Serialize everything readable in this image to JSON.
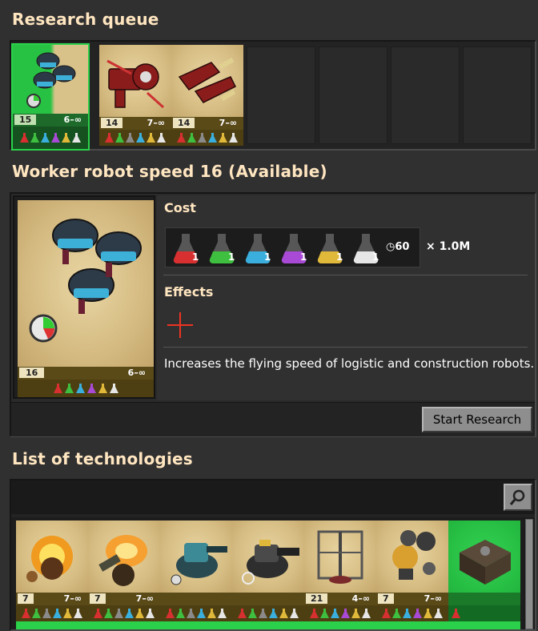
{
  "queue": {
    "title": "Research queue",
    "items": [
      {
        "level": "15",
        "range": "6–∞",
        "name": "Worker robot speed",
        "state": "active"
      },
      {
        "level": "14",
        "range": "7–∞",
        "name": "Physical projectile damage",
        "state": "queued"
      },
      {
        "level": "14",
        "range": "7–∞",
        "name": "Weapon shooting speed",
        "state": "queued"
      }
    ]
  },
  "selected": {
    "title": "Worker robot speed 16 (Available)",
    "level": "16",
    "range": "6–∞",
    "cost_label": "Cost",
    "packs": [
      {
        "color": "#d83030",
        "count": "1",
        "name": "automation-science-pack"
      },
      {
        "color": "#3fbf3f",
        "count": "1",
        "name": "logistic-science-pack"
      },
      {
        "color": "#3aaedc",
        "count": "1",
        "name": "chemical-science-pack"
      },
      {
        "color": "#a94ad6",
        "count": "1",
        "name": "production-science-pack"
      },
      {
        "color": "#e0b83a",
        "count": "1",
        "name": "utility-science-pack"
      },
      {
        "color": "#e6e6e6",
        "count": "1",
        "name": "space-science-pack"
      }
    ],
    "time": "60",
    "multiplier": "× 1.0M",
    "effects_label": "Effects",
    "description": "Increases the flying speed of logistic and construction robots.",
    "button_label": "Start Research"
  },
  "list": {
    "title": "List of technologies",
    "search_placeholder": "",
    "items": [
      {
        "level": "7",
        "range": "7–∞",
        "name": "Stronger explosives"
      },
      {
        "level": "7",
        "range": "7–∞",
        "name": "Refined flammables"
      },
      {
        "level": "",
        "range": "",
        "name": "Laser turret research"
      },
      {
        "level": "",
        "range": "",
        "name": "Gun turret research"
      },
      {
        "level": "21",
        "range": "4–∞",
        "name": "Mining productivity"
      },
      {
        "level": "7",
        "range": "7–∞",
        "name": "Follower robot count"
      },
      {
        "level": "",
        "range": "",
        "name": "Completed technology"
      }
    ]
  },
  "colors": {
    "accent_green": "#2bd14a",
    "title_cream": "#ffe6c0",
    "tile_tan": "#c9b37a"
  }
}
